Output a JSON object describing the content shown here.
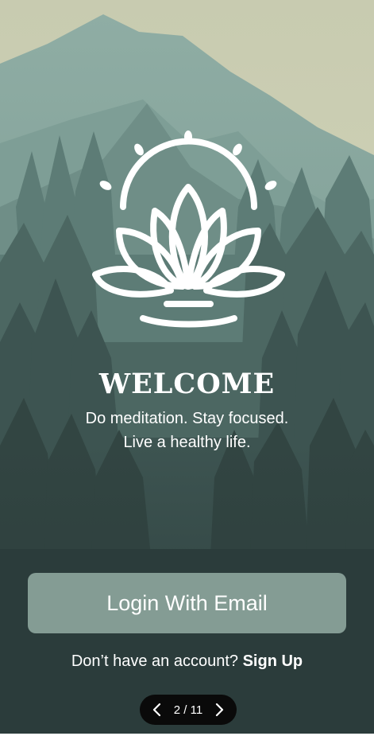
{
  "welcome": {
    "title": "WELCOME",
    "subtitle_line1": "Do meditation. Stay focused.",
    "subtitle_line2": "Live a healthy life."
  },
  "actions": {
    "login_label": "Login With Email",
    "signup_prompt": "Don’t have an account?",
    "signup_link": "Sign Up"
  },
  "pager": {
    "current": 2,
    "total": 11,
    "label": "2 / 11"
  },
  "icons": {
    "logo": "lotus-icon",
    "prev": "chevron-left-icon",
    "next": "chevron-right-icon"
  },
  "colors": {
    "sky": "#d4d7bb",
    "button": "#849c94",
    "text": "#ffffff",
    "pager_bg": "#0a0a0a"
  }
}
